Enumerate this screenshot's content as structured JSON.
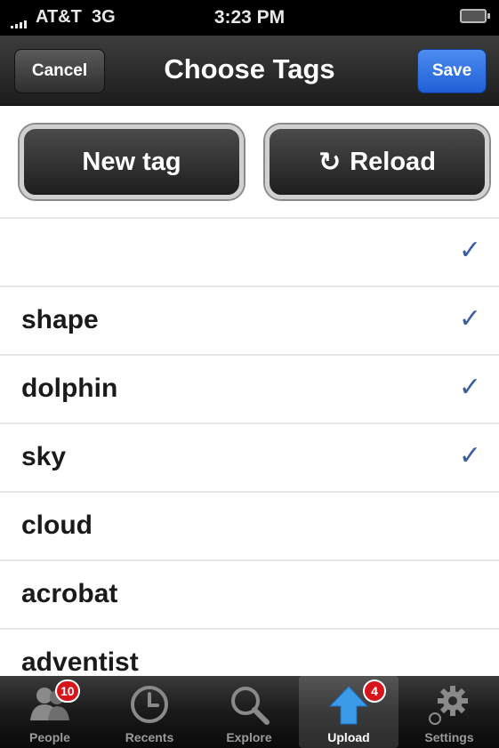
{
  "status_bar": {
    "carrier": "AT&T",
    "network": "3G",
    "time": "3:23 PM"
  },
  "nav": {
    "title": "Choose Tags",
    "cancel_label": "Cancel",
    "save_label": "Save"
  },
  "actions": {
    "new_tag_label": "New tag",
    "reload_label": "Reload"
  },
  "tags": [
    {
      "label": "",
      "checked": true
    },
    {
      "label": "shape",
      "checked": true
    },
    {
      "label": "dolphin",
      "checked": true
    },
    {
      "label": "sky",
      "checked": true
    },
    {
      "label": "cloud",
      "checked": false
    },
    {
      "label": "acrobat",
      "checked": false
    },
    {
      "label": "adventist",
      "checked": false
    }
  ],
  "tab_bar": {
    "items": [
      {
        "label": "People",
        "icon": "people-icon",
        "badge": "10"
      },
      {
        "label": "Recents",
        "icon": "clock-icon",
        "badge": ""
      },
      {
        "label": "Explore",
        "icon": "magnifier-icon",
        "badge": ""
      },
      {
        "label": "Upload",
        "icon": "upload-arrow-icon",
        "badge": "4",
        "selected": true
      },
      {
        "label": "Settings",
        "icon": "gear-icon",
        "badge": ""
      }
    ]
  },
  "colors": {
    "save_button": "#1f5fd6",
    "check": "#3a5fa0",
    "badge": "#d8141b"
  }
}
